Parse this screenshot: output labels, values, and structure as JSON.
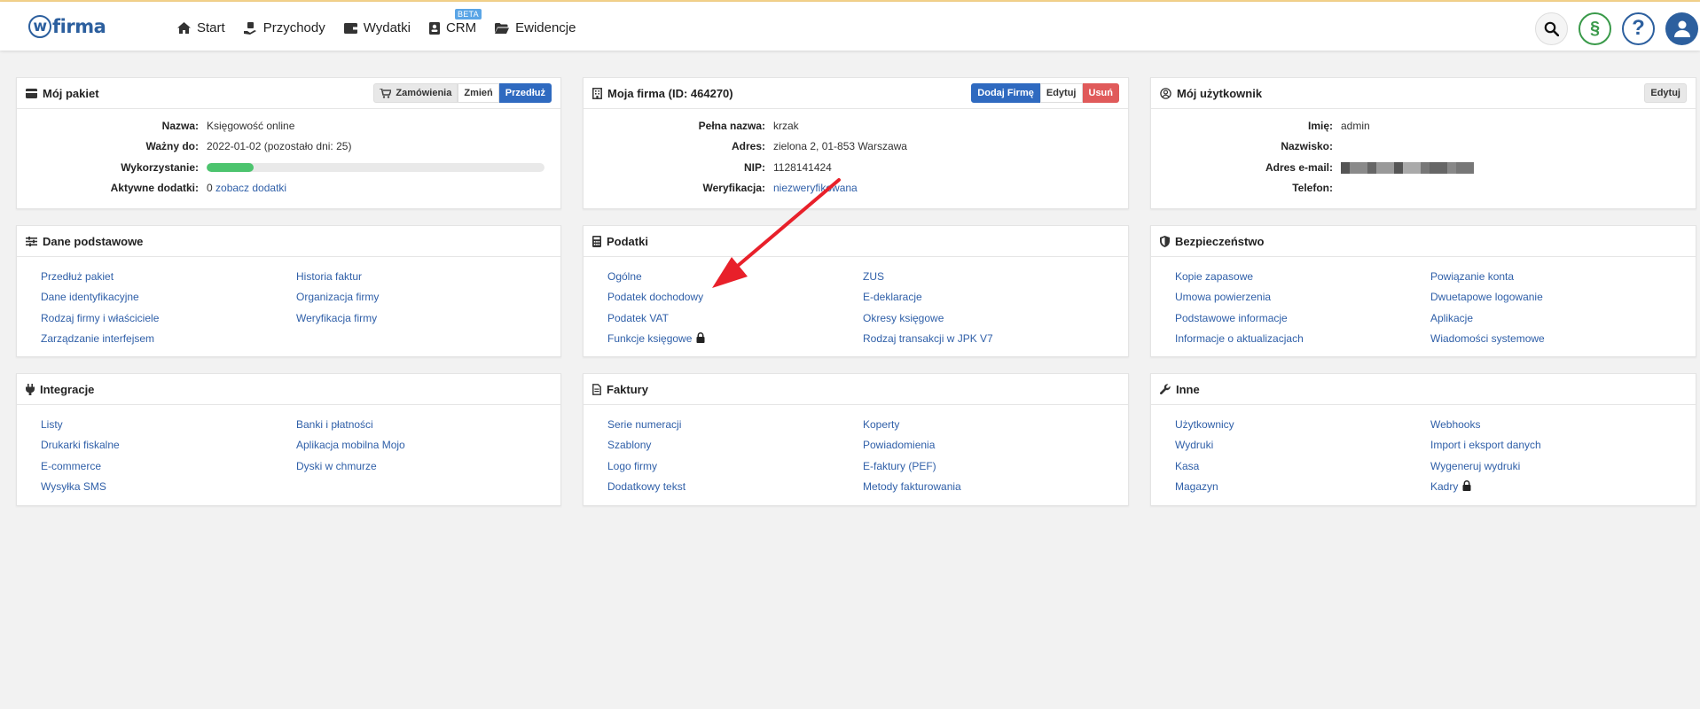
{
  "brand": {
    "logo_w": "w",
    "logo_rest": "firma"
  },
  "nav": {
    "items": [
      {
        "label": "Start"
      },
      {
        "label": "Przychody"
      },
      {
        "label": "Wydatki"
      },
      {
        "label": "CRM",
        "badge": "BETA"
      },
      {
        "label": "Ewidencje"
      }
    ]
  },
  "header_icons": [
    "search-icon",
    "paragraph-icon",
    "help-icon",
    "user-icon"
  ],
  "colors": {
    "accent": "#2f6ac0",
    "link": "#2f5fa8",
    "success": "#4cc46e",
    "danger": "#e05a5a"
  },
  "panels": {
    "package": {
      "title": "Mój pakiet",
      "buttons": [
        "Zamówienia",
        "Zmień",
        "Przedłuż"
      ],
      "rows": [
        {
          "key": "Nazwa:",
          "value": "Księgowość online"
        },
        {
          "key": "Ważny do:",
          "value": "2022-01-02 (pozostało dni: 25)"
        },
        {
          "key": "Wykorzystanie:",
          "progress": 0.14
        },
        {
          "key": "Aktywne dodatki:",
          "value": "0",
          "link": "zobacz dodatki"
        }
      ]
    },
    "company": {
      "title": "Moja firma (ID: 464270)",
      "buttons": [
        "Dodaj Firmę",
        "Edytuj",
        "Usuń"
      ],
      "rows": [
        {
          "key": "Pełna nazwa:",
          "value": "krzak"
        },
        {
          "key": "Adres:",
          "value": "zielona 2, 01-853 Warszawa"
        },
        {
          "key": "NIP:",
          "value": "1128141424"
        },
        {
          "key": "Weryfikacja:",
          "link": "niezweryfikowana"
        }
      ]
    },
    "user": {
      "title": "Mój użytkownik",
      "buttons": [
        "Edytuj"
      ],
      "rows": [
        {
          "key": "Imię:",
          "value": "admin"
        },
        {
          "key": "Nazwisko:",
          "value": ""
        },
        {
          "key": "Adres e-mail:",
          "value": ""
        },
        {
          "key": "Telefon:",
          "value": ""
        }
      ]
    },
    "basic": {
      "title": "Dane podstawowe",
      "left": [
        "Przedłuż pakiet",
        "Dane identyfikacyjne",
        "Rodzaj firmy i właściciele",
        "Zarządzanie interfejsem"
      ],
      "right": [
        "Historia faktur",
        "Organizacja firmy",
        "Weryfikacja firmy"
      ]
    },
    "taxes": {
      "title": "Podatki",
      "left": [
        "Ogólne",
        "Podatek dochodowy",
        "Podatek VAT",
        "Funkcje księgowe"
      ],
      "right": [
        "ZUS",
        "E-deklaracje",
        "Okresy księgowe",
        "Rodzaj transakcji w JPK V7"
      ]
    },
    "security": {
      "title": "Bezpieczeństwo",
      "left": [
        "Kopie zapasowe",
        "Umowa powierzenia",
        "Podstawowe informacje",
        "Informacje o aktualizacjach"
      ],
      "right": [
        "Powiązanie konta",
        "Dwuetapowe logowanie",
        "Aplikacje",
        "Wiadomości systemowe"
      ]
    },
    "integrations": {
      "title": "Integracje",
      "left": [
        "Listy",
        "Drukarki fiskalne",
        "E-commerce",
        "Wysyłka SMS"
      ],
      "right": [
        "Banki i płatności",
        "Aplikacja mobilna Mojo",
        "Dyski w chmurze"
      ]
    },
    "invoices": {
      "title": "Faktury",
      "left": [
        "Serie numeracji",
        "Szablony",
        "Logo firmy",
        "Dodatkowy tekst"
      ],
      "right": [
        "Koperty",
        "Powiadomienia",
        "E-faktury (PEF)",
        "Metody fakturowania"
      ]
    },
    "other": {
      "title": "Inne",
      "left": [
        "Użytkownicy",
        "Wydruki",
        "Kasa",
        "Magazyn"
      ],
      "right": [
        "Webhooks",
        "Import i eksport danych",
        "Wygeneruj wydruki",
        "Kadry"
      ]
    }
  }
}
